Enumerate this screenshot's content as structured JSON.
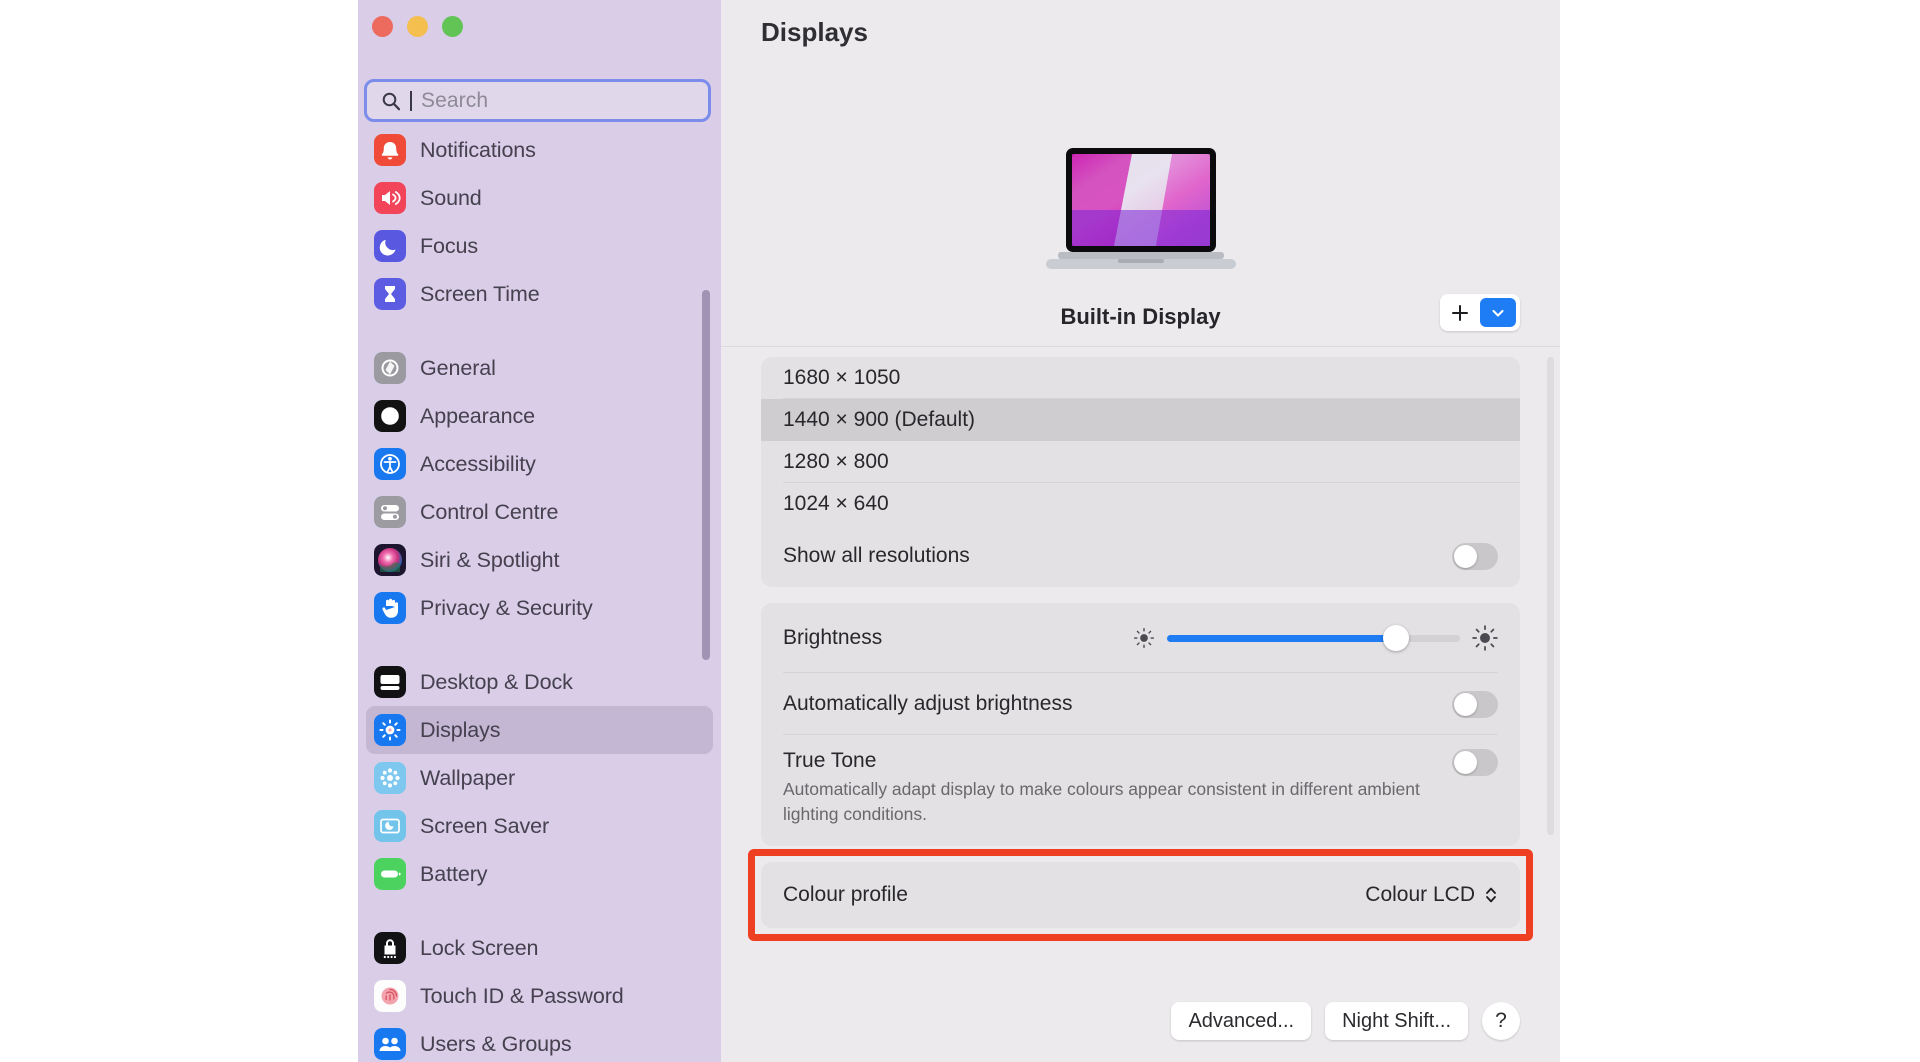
{
  "window": {
    "traffic_lights": [
      {
        "name": "close",
        "color": "#ec6a5e"
      },
      {
        "name": "minimize",
        "color": "#f4bf4f"
      },
      {
        "name": "zoom",
        "color": "#61c454"
      }
    ]
  },
  "search": {
    "placeholder": "Search",
    "value": "",
    "icon": "search-icon"
  },
  "sidebar": {
    "groups": [
      {
        "items": [
          {
            "label": "Notifications",
            "icon": "notifications-icon",
            "selected": false
          },
          {
            "label": "Sound",
            "icon": "sound-icon",
            "selected": false
          },
          {
            "label": "Focus",
            "icon": "focus-icon",
            "selected": false
          },
          {
            "label": "Screen Time",
            "icon": "screen-time-icon",
            "selected": false
          }
        ]
      },
      {
        "items": [
          {
            "label": "General",
            "icon": "general-icon",
            "selected": false
          },
          {
            "label": "Appearance",
            "icon": "appearance-icon",
            "selected": false
          },
          {
            "label": "Accessibility",
            "icon": "accessibility-icon",
            "selected": false
          },
          {
            "label": "Control Centre",
            "icon": "control-centre-icon",
            "selected": false
          },
          {
            "label": "Siri & Spotlight",
            "icon": "siri-spotlight-icon",
            "selected": false
          },
          {
            "label": "Privacy & Security",
            "icon": "privacy-security-icon",
            "selected": false
          }
        ]
      },
      {
        "items": [
          {
            "label": "Desktop & Dock",
            "icon": "desktop-dock-icon",
            "selected": false
          },
          {
            "label": "Displays",
            "icon": "displays-icon",
            "selected": true
          },
          {
            "label": "Wallpaper",
            "icon": "wallpaper-icon",
            "selected": false
          },
          {
            "label": "Screen Saver",
            "icon": "screen-saver-icon",
            "selected": false
          },
          {
            "label": "Battery",
            "icon": "battery-icon",
            "selected": false
          }
        ]
      },
      {
        "items": [
          {
            "label": "Lock Screen",
            "icon": "lock-screen-icon",
            "selected": false
          },
          {
            "label": "Touch ID & Password",
            "icon": "touch-id-icon",
            "selected": false
          },
          {
            "label": "Users & Groups",
            "icon": "users-groups-icon",
            "selected": false
          }
        ]
      }
    ]
  },
  "main": {
    "title": "Displays",
    "display_name": "Built-in Display",
    "add_display": {
      "add_icon": "plus-icon",
      "chevron_icon": "chevron-down-icon"
    },
    "resolutions": [
      {
        "label": "1680 × 1050",
        "selected": false
      },
      {
        "label": "1440 × 900 (Default)",
        "selected": true
      },
      {
        "label": "1280 × 800",
        "selected": false
      },
      {
        "label": "1024 × 640",
        "selected": false
      }
    ],
    "show_all_resolutions": {
      "label": "Show all resolutions",
      "enabled": false
    },
    "brightness": {
      "label": "Brightness",
      "value_percent": 78,
      "low_icon": "brightness-low-icon",
      "high_icon": "brightness-high-icon"
    },
    "auto_brightness": {
      "label": "Automatically adjust brightness",
      "enabled": false
    },
    "true_tone": {
      "label": "True Tone",
      "description": "Automatically adapt display to make colours appear consistent in different ambient lighting conditions.",
      "enabled": false
    },
    "colour_profile": {
      "label": "Colour profile",
      "value": "Colour LCD",
      "chevron_icon": "up-down-chevron-icon",
      "highlight_color": "#ee3f23"
    },
    "footer": {
      "advanced_label": "Advanced...",
      "night_shift_label": "Night Shift...",
      "help_label": "?"
    }
  }
}
